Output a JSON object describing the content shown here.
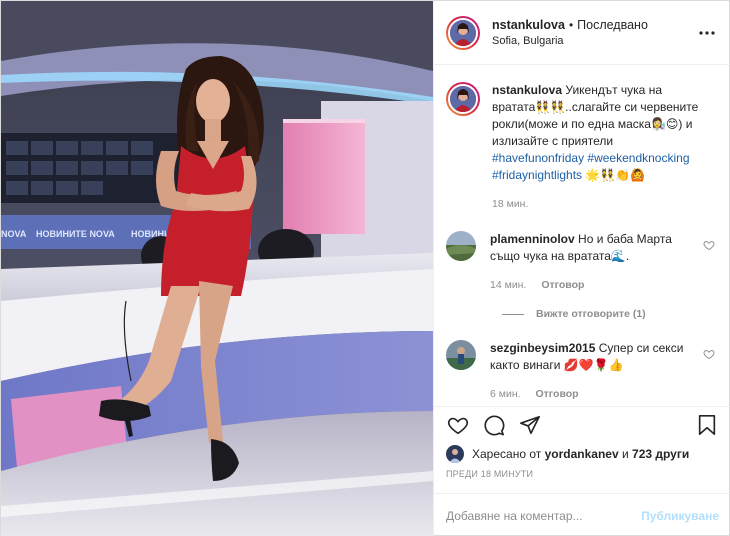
{
  "header": {
    "username": "nstankulova",
    "separator": "•",
    "follow_status": "Последвано",
    "location": "Sofia, Bulgaria"
  },
  "caption": {
    "username": "nstankulova",
    "text_1": "Уикендът чука на вратата",
    "emoji_1": "👯👯",
    "text_2": "..слагайте си червените рокли(може и по една маска",
    "emoji_2": "👩‍🔬😊",
    "text_3": ") и излизайте с приятели",
    "hashtags": [
      "#havefunonfriday",
      "#weekendknocking",
      "#fridaynightlights"
    ],
    "emoji_3": "🌟👯👏🙆",
    "time": "18 мин."
  },
  "comments": [
    {
      "username": "plamenninolov",
      "text": "Но и баба Марта също чука на вратата",
      "emoji": "🌊.",
      "time": "14 мин.",
      "reply_label": "Отговор",
      "view_replies": "Вижте отговорите (1)"
    },
    {
      "username": "sezginbeysim2015",
      "text": "Супер си секси както винаги",
      "emoji": "💋❤️🌹👍",
      "time": "6 мин.",
      "reply_label": "Отговор"
    }
  ],
  "likes": {
    "prefix": "Харесано от",
    "liker": "yordankanev",
    "connector": "и",
    "others": "723 други"
  },
  "timestamp": "ПРЕДИ 18 МИНУТИ",
  "add_comment": {
    "placeholder": "Добавяне на коментар...",
    "post_label": "Публикуване"
  },
  "photo": {
    "screen_text_1": "НОВИНИТЕ NOVA",
    "screen_text_2": "НОВИНИТЕ",
    "screen_text_3": "NOVA"
  }
}
